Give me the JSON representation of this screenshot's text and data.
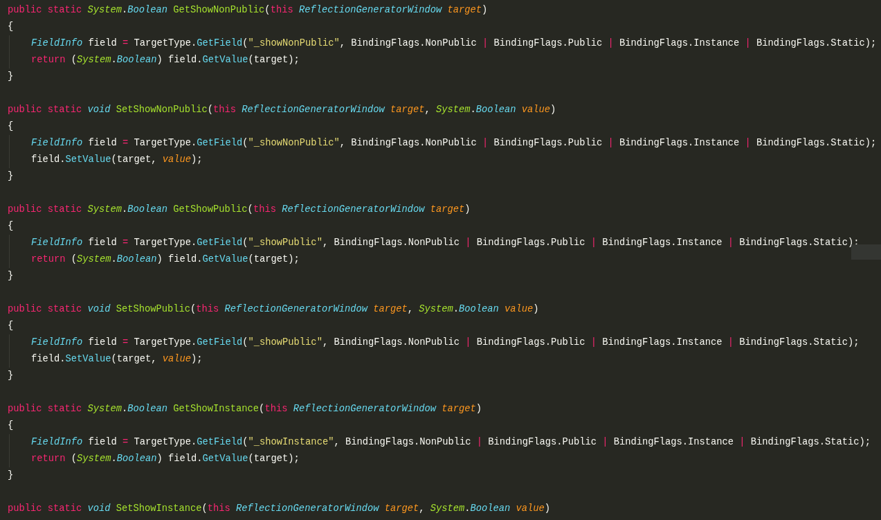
{
  "editor": {
    "methods": [
      {
        "lines": [
          {
            "indent": false,
            "tokens": [
              {
                "kind": "kw",
                "text": "public static "
              },
              {
                "kind": "ns",
                "text": "System"
              },
              {
                "kind": "plain",
                "text": "."
              },
              {
                "kind": "type",
                "text": "Boolean "
              },
              {
                "kind": "fn",
                "text": "GetShowNonPublic"
              },
              {
                "kind": "plain",
                "text": "("
              },
              {
                "kind": "kw",
                "text": "this "
              },
              {
                "kind": "type",
                "text": "ReflectionGeneratorWindow "
              },
              {
                "kind": "param",
                "text": "target"
              },
              {
                "kind": "plain",
                "text": ")"
              }
            ]
          },
          {
            "indent": false,
            "tokens": [
              {
                "kind": "plain",
                "text": "{"
              }
            ]
          },
          {
            "indent": true,
            "tokens": [
              {
                "kind": "type",
                "text": "FieldInfo"
              },
              {
                "kind": "plain",
                "text": " field "
              },
              {
                "kind": "op",
                "text": "="
              },
              {
                "kind": "plain",
                "text": " TargetType."
              },
              {
                "kind": "call",
                "text": "GetField"
              },
              {
                "kind": "plain",
                "text": "("
              },
              {
                "kind": "str",
                "text": "\"_showNonPublic\""
              },
              {
                "kind": "plain",
                "text": ", BindingFlags.NonPublic "
              },
              {
                "kind": "op",
                "text": "|"
              },
              {
                "kind": "plain",
                "text": " BindingFlags.Public "
              },
              {
                "kind": "op",
                "text": "|"
              },
              {
                "kind": "plain",
                "text": " BindingFlags.Instance "
              },
              {
                "kind": "op",
                "text": "|"
              },
              {
                "kind": "plain",
                "text": " BindingFlags.Static);"
              }
            ]
          },
          {
            "indent": true,
            "tokens": [
              {
                "kind": "kw",
                "text": "return"
              },
              {
                "kind": "plain",
                "text": " ("
              },
              {
                "kind": "ns",
                "text": "System"
              },
              {
                "kind": "plain",
                "text": "."
              },
              {
                "kind": "type",
                "text": "Boolean"
              },
              {
                "kind": "plain",
                "text": ") field."
              },
              {
                "kind": "call",
                "text": "GetValue"
              },
              {
                "kind": "plain",
                "text": "(target);"
              }
            ]
          },
          {
            "indent": false,
            "tokens": [
              {
                "kind": "plain",
                "text": "}"
              }
            ]
          }
        ]
      },
      {
        "lines": [
          {
            "indent": false,
            "tokens": [
              {
                "kind": "kw",
                "text": "public static "
              },
              {
                "kind": "type",
                "text": "void "
              },
              {
                "kind": "fn",
                "text": "SetShowNonPublic"
              },
              {
                "kind": "plain",
                "text": "("
              },
              {
                "kind": "kw",
                "text": "this "
              },
              {
                "kind": "type",
                "text": "ReflectionGeneratorWindow "
              },
              {
                "kind": "param",
                "text": "target"
              },
              {
                "kind": "plain",
                "text": ", "
              },
              {
                "kind": "ns",
                "text": "System"
              },
              {
                "kind": "plain",
                "text": "."
              },
              {
                "kind": "type",
                "text": "Boolean "
              },
              {
                "kind": "param",
                "text": "value"
              },
              {
                "kind": "plain",
                "text": ")"
              }
            ]
          },
          {
            "indent": false,
            "tokens": [
              {
                "kind": "plain",
                "text": "{"
              }
            ]
          },
          {
            "indent": true,
            "tokens": [
              {
                "kind": "type",
                "text": "FieldInfo"
              },
              {
                "kind": "plain",
                "text": " field "
              },
              {
                "kind": "op",
                "text": "="
              },
              {
                "kind": "plain",
                "text": " TargetType."
              },
              {
                "kind": "call",
                "text": "GetField"
              },
              {
                "kind": "plain",
                "text": "("
              },
              {
                "kind": "str",
                "text": "\"_showNonPublic\""
              },
              {
                "kind": "plain",
                "text": ", BindingFlags.NonPublic "
              },
              {
                "kind": "op",
                "text": "|"
              },
              {
                "kind": "plain",
                "text": " BindingFlags.Public "
              },
              {
                "kind": "op",
                "text": "|"
              },
              {
                "kind": "plain",
                "text": " BindingFlags.Instance "
              },
              {
                "kind": "op",
                "text": "|"
              },
              {
                "kind": "plain",
                "text": " BindingFlags.Static);"
              }
            ]
          },
          {
            "indent": true,
            "tokens": [
              {
                "kind": "plain",
                "text": "field."
              },
              {
                "kind": "call",
                "text": "SetValue"
              },
              {
                "kind": "plain",
                "text": "(target, "
              },
              {
                "kind": "param",
                "text": "value"
              },
              {
                "kind": "plain",
                "text": ");"
              }
            ]
          },
          {
            "indent": false,
            "tokens": [
              {
                "kind": "plain",
                "text": "}"
              }
            ]
          }
        ]
      },
      {
        "lines": [
          {
            "indent": false,
            "tokens": [
              {
                "kind": "kw",
                "text": "public static "
              },
              {
                "kind": "ns",
                "text": "System"
              },
              {
                "kind": "plain",
                "text": "."
              },
              {
                "kind": "type",
                "text": "Boolean "
              },
              {
                "kind": "fn",
                "text": "GetShowPublic"
              },
              {
                "kind": "plain",
                "text": "("
              },
              {
                "kind": "kw",
                "text": "this "
              },
              {
                "kind": "type",
                "text": "ReflectionGeneratorWindow "
              },
              {
                "kind": "param",
                "text": "target"
              },
              {
                "kind": "plain",
                "text": ")"
              }
            ]
          },
          {
            "indent": false,
            "tokens": [
              {
                "kind": "plain",
                "text": "{"
              }
            ]
          },
          {
            "indent": true,
            "tokens": [
              {
                "kind": "type",
                "text": "FieldInfo"
              },
              {
                "kind": "plain",
                "text": " field "
              },
              {
                "kind": "op",
                "text": "="
              },
              {
                "kind": "plain",
                "text": " TargetType."
              },
              {
                "kind": "call",
                "text": "GetField"
              },
              {
                "kind": "plain",
                "text": "("
              },
              {
                "kind": "str",
                "text": "\"_showPublic\""
              },
              {
                "kind": "plain",
                "text": ", BindingFlags.NonPublic "
              },
              {
                "kind": "op",
                "text": "|"
              },
              {
                "kind": "plain",
                "text": " BindingFlags.Public "
              },
              {
                "kind": "op",
                "text": "|"
              },
              {
                "kind": "plain",
                "text": " BindingFlags.Instance "
              },
              {
                "kind": "op",
                "text": "|"
              },
              {
                "kind": "plain",
                "text": " BindingFlags.Static);"
              }
            ]
          },
          {
            "indent": true,
            "tokens": [
              {
                "kind": "kw",
                "text": "return"
              },
              {
                "kind": "plain",
                "text": " ("
              },
              {
                "kind": "ns",
                "text": "System"
              },
              {
                "kind": "plain",
                "text": "."
              },
              {
                "kind": "type",
                "text": "Boolean"
              },
              {
                "kind": "plain",
                "text": ") field."
              },
              {
                "kind": "call",
                "text": "GetValue"
              },
              {
                "kind": "plain",
                "text": "(target);"
              }
            ]
          },
          {
            "indent": false,
            "tokens": [
              {
                "kind": "plain",
                "text": "}"
              }
            ]
          }
        ]
      },
      {
        "lines": [
          {
            "indent": false,
            "tokens": [
              {
                "kind": "kw",
                "text": "public static "
              },
              {
                "kind": "type",
                "text": "void "
              },
              {
                "kind": "fn",
                "text": "SetShowPublic"
              },
              {
                "kind": "plain",
                "text": "("
              },
              {
                "kind": "kw",
                "text": "this "
              },
              {
                "kind": "type",
                "text": "ReflectionGeneratorWindow "
              },
              {
                "kind": "param",
                "text": "target"
              },
              {
                "kind": "plain",
                "text": ", "
              },
              {
                "kind": "ns",
                "text": "System"
              },
              {
                "kind": "plain",
                "text": "."
              },
              {
                "kind": "type",
                "text": "Boolean "
              },
              {
                "kind": "param",
                "text": "value"
              },
              {
                "kind": "plain",
                "text": ")"
              }
            ]
          },
          {
            "indent": false,
            "tokens": [
              {
                "kind": "plain",
                "text": "{"
              }
            ]
          },
          {
            "indent": true,
            "tokens": [
              {
                "kind": "type",
                "text": "FieldInfo"
              },
              {
                "kind": "plain",
                "text": " field "
              },
              {
                "kind": "op",
                "text": "="
              },
              {
                "kind": "plain",
                "text": " TargetType."
              },
              {
                "kind": "call",
                "text": "GetField"
              },
              {
                "kind": "plain",
                "text": "("
              },
              {
                "kind": "str",
                "text": "\"_showPublic\""
              },
              {
                "kind": "plain",
                "text": ", BindingFlags.NonPublic "
              },
              {
                "kind": "op",
                "text": "|"
              },
              {
                "kind": "plain",
                "text": " BindingFlags.Public "
              },
              {
                "kind": "op",
                "text": "|"
              },
              {
                "kind": "plain",
                "text": " BindingFlags.Instance "
              },
              {
                "kind": "op",
                "text": "|"
              },
              {
                "kind": "plain",
                "text": " BindingFlags.Static);"
              }
            ]
          },
          {
            "indent": true,
            "tokens": [
              {
                "kind": "plain",
                "text": "field."
              },
              {
                "kind": "call",
                "text": "SetValue"
              },
              {
                "kind": "plain",
                "text": "(target, "
              },
              {
                "kind": "param",
                "text": "value"
              },
              {
                "kind": "plain",
                "text": ");"
              }
            ]
          },
          {
            "indent": false,
            "tokens": [
              {
                "kind": "plain",
                "text": "}"
              }
            ]
          }
        ]
      },
      {
        "lines": [
          {
            "indent": false,
            "tokens": [
              {
                "kind": "kw",
                "text": "public static "
              },
              {
                "kind": "ns",
                "text": "System"
              },
              {
                "kind": "plain",
                "text": "."
              },
              {
                "kind": "type",
                "text": "Boolean "
              },
              {
                "kind": "fn",
                "text": "GetShowInstance"
              },
              {
                "kind": "plain",
                "text": "("
              },
              {
                "kind": "kw",
                "text": "this "
              },
              {
                "kind": "type",
                "text": "ReflectionGeneratorWindow "
              },
              {
                "kind": "param",
                "text": "target"
              },
              {
                "kind": "plain",
                "text": ")"
              }
            ]
          },
          {
            "indent": false,
            "tokens": [
              {
                "kind": "plain",
                "text": "{"
              }
            ]
          },
          {
            "indent": true,
            "tokens": [
              {
                "kind": "type",
                "text": "FieldInfo"
              },
              {
                "kind": "plain",
                "text": " field "
              },
              {
                "kind": "op",
                "text": "="
              },
              {
                "kind": "plain",
                "text": " TargetType."
              },
              {
                "kind": "call",
                "text": "GetField"
              },
              {
                "kind": "plain",
                "text": "("
              },
              {
                "kind": "str",
                "text": "\"_showInstance\""
              },
              {
                "kind": "plain",
                "text": ", BindingFlags.NonPublic "
              },
              {
                "kind": "op",
                "text": "|"
              },
              {
                "kind": "plain",
                "text": " BindingFlags.Public "
              },
              {
                "kind": "op",
                "text": "|"
              },
              {
                "kind": "plain",
                "text": " BindingFlags.Instance "
              },
              {
                "kind": "op",
                "text": "|"
              },
              {
                "kind": "plain",
                "text": " BindingFlags.Static);"
              }
            ]
          },
          {
            "indent": true,
            "tokens": [
              {
                "kind": "kw",
                "text": "return"
              },
              {
                "kind": "plain",
                "text": " ("
              },
              {
                "kind": "ns",
                "text": "System"
              },
              {
                "kind": "plain",
                "text": "."
              },
              {
                "kind": "type",
                "text": "Boolean"
              },
              {
                "kind": "plain",
                "text": ") field."
              },
              {
                "kind": "call",
                "text": "GetValue"
              },
              {
                "kind": "plain",
                "text": "(target);"
              }
            ]
          },
          {
            "indent": false,
            "tokens": [
              {
                "kind": "plain",
                "text": "}"
              }
            ]
          }
        ]
      },
      {
        "lines": [
          {
            "indent": false,
            "tokens": [
              {
                "kind": "kw",
                "text": "public static "
              },
              {
                "kind": "type",
                "text": "void "
              },
              {
                "kind": "fn",
                "text": "SetShowInstance"
              },
              {
                "kind": "plain",
                "text": "("
              },
              {
                "kind": "kw",
                "text": "this "
              },
              {
                "kind": "type",
                "text": "ReflectionGeneratorWindow "
              },
              {
                "kind": "param",
                "text": "target"
              },
              {
                "kind": "plain",
                "text": ", "
              },
              {
                "kind": "ns",
                "text": "System"
              },
              {
                "kind": "plain",
                "text": "."
              },
              {
                "kind": "type",
                "text": "Boolean "
              },
              {
                "kind": "param",
                "text": "value"
              },
              {
                "kind": "plain",
                "text": ")"
              }
            ]
          }
        ]
      }
    ]
  }
}
